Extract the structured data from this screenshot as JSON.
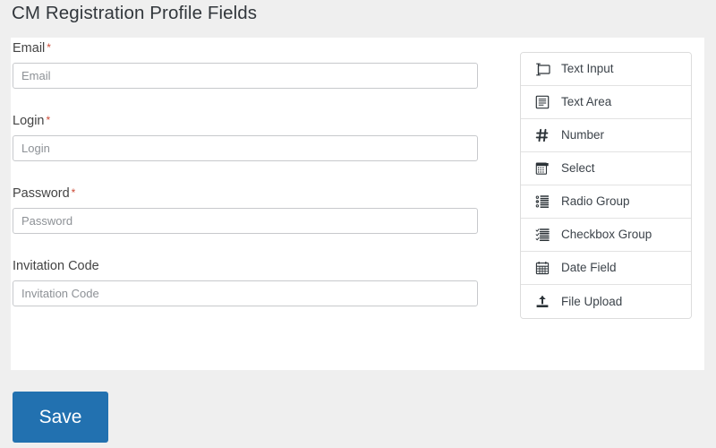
{
  "page": {
    "title": "CM Registration Profile Fields",
    "background_color": "#efefef",
    "card_background_color": "#ffffff"
  },
  "form": {
    "fields": [
      {
        "label": "Email",
        "required": true,
        "required_marker": "*",
        "placeholder": "Email",
        "value": "",
        "name": "email"
      },
      {
        "label": "Login",
        "required": true,
        "required_marker": "*",
        "placeholder": "Login",
        "value": "",
        "name": "login"
      },
      {
        "label": "Password",
        "required": true,
        "required_marker": "*",
        "placeholder": "Password",
        "value": "",
        "name": "password"
      },
      {
        "label": "Invitation Code",
        "required": false,
        "required_marker": "",
        "placeholder": "Invitation Code",
        "value": "",
        "name": "invitation-code"
      }
    ]
  },
  "field_types_panel": {
    "items": [
      {
        "label": "Text Input",
        "icon": "text-input-icon"
      },
      {
        "label": "Text Area",
        "icon": "text-area-icon"
      },
      {
        "label": "Number",
        "icon": "number-hash-icon"
      },
      {
        "label": "Select",
        "icon": "select-dropdown-icon"
      },
      {
        "label": "Radio Group",
        "icon": "radio-group-icon"
      },
      {
        "label": "Checkbox Group",
        "icon": "checkbox-group-icon"
      },
      {
        "label": "Date Field",
        "icon": "calendar-icon"
      },
      {
        "label": "File Upload",
        "icon": "file-upload-icon"
      }
    ]
  },
  "actions": {
    "save_label": "Save",
    "save_color": "#2271b0"
  },
  "colors": {
    "required_asterisk": "#cc4b37",
    "label_text": "#444444",
    "placeholder_text": "#8d9196",
    "border": "#c7c9cc",
    "accent": "#2271b0"
  }
}
